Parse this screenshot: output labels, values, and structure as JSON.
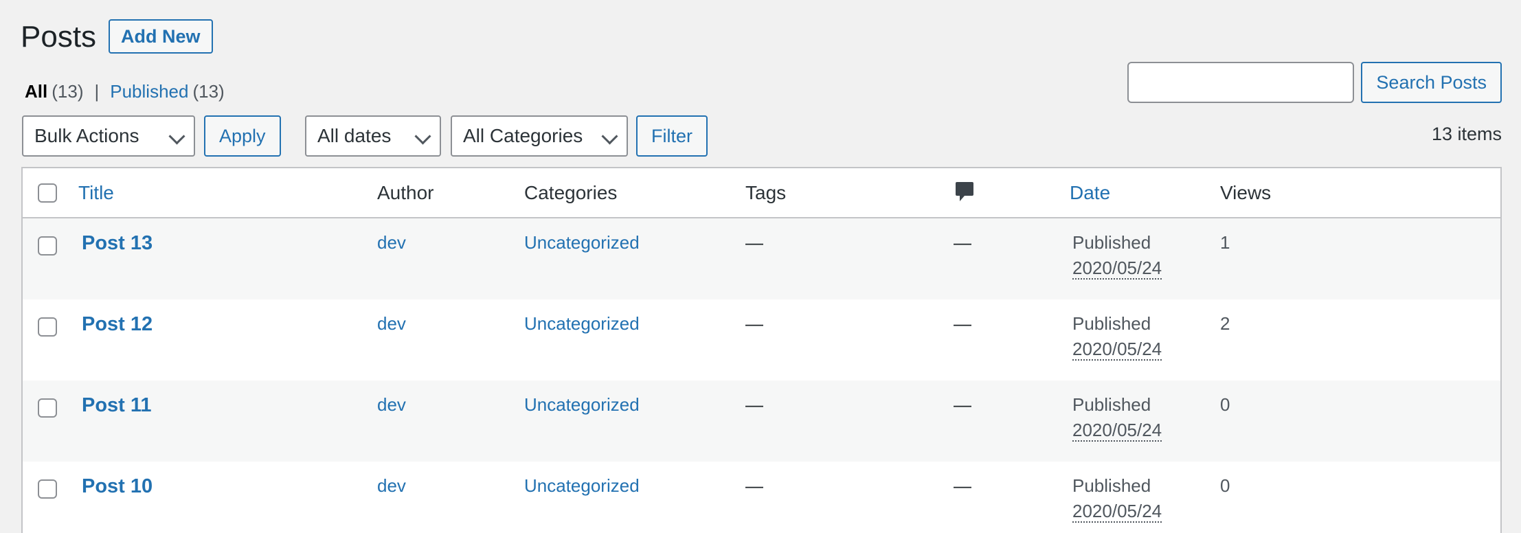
{
  "header": {
    "title": "Posts",
    "add_new_label": "Add New"
  },
  "views": {
    "all_label": "All",
    "all_count": "(13)",
    "separator": "|",
    "published_label": "Published",
    "published_count": "(13)"
  },
  "search": {
    "value": "",
    "placeholder": "",
    "button_label": "Search Posts"
  },
  "tablenav": {
    "bulk_actions": "Bulk Actions",
    "apply_label": "Apply",
    "dates": "All dates",
    "categories": "All Categories",
    "filter_label": "Filter",
    "items_count": "13 items"
  },
  "table": {
    "columns": {
      "title": "Title",
      "author": "Author",
      "categories": "Categories",
      "tags": "Tags",
      "comments_icon": "comment-bubble-icon",
      "date": "Date",
      "views": "Views"
    },
    "rows": [
      {
        "title": "Post 13",
        "author": "dev",
        "category": "Uncategorized",
        "tags": "—",
        "comments": "—",
        "status": "Published",
        "date": "2020/05/24",
        "views": "1"
      },
      {
        "title": "Post 12",
        "author": "dev",
        "category": "Uncategorized",
        "tags": "—",
        "comments": "—",
        "status": "Published",
        "date": "2020/05/24",
        "views": "2"
      },
      {
        "title": "Post 11",
        "author": "dev",
        "category": "Uncategorized",
        "tags": "—",
        "comments": "—",
        "status": "Published",
        "date": "2020/05/24",
        "views": "0"
      },
      {
        "title": "Post 10",
        "author": "dev",
        "category": "Uncategorized",
        "tags": "—",
        "comments": "—",
        "status": "Published",
        "date": "2020/05/24",
        "views": "0"
      }
    ]
  },
  "colors": {
    "accent": "#2271b1",
    "background": "#f1f1f1",
    "border": "#c3c4c7",
    "text": "#1d2327",
    "row_alt": "#f6f7f7"
  }
}
